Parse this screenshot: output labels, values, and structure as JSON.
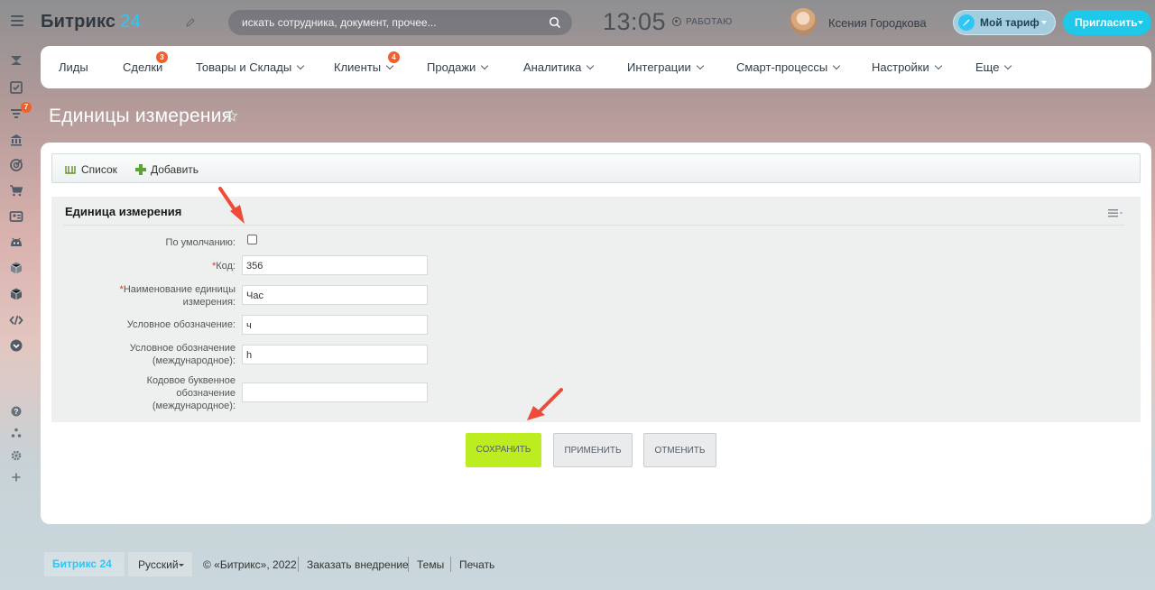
{
  "header": {
    "logo_text": "Битрикс",
    "logo_num": "24",
    "search_placeholder": "искать сотрудника, документ, прочее...",
    "time": "13:05",
    "work_status": "РАБОТАЮ",
    "user_name": "Ксения Городкова",
    "tariff_label": "Мой тариф",
    "invite_label": "Пригласить"
  },
  "left_bar": {
    "badge_count": "7",
    "icons": [
      "feed-icon",
      "tasks-icon",
      "crm-funnel-icon",
      "bank-icon",
      "target-icon",
      "cart-icon",
      "contact-card-icon",
      "robot-icon",
      "box-icon",
      "cube-icon",
      "code-icon",
      "chevron-down-circle-icon",
      "help-icon",
      "structure-icon",
      "settings-icon",
      "plus-icon"
    ]
  },
  "menu": {
    "items": [
      {
        "label": "Лиды",
        "badge": "",
        "has_chevron": false
      },
      {
        "label": "Сделки",
        "badge": "3",
        "has_chevron": false
      },
      {
        "label": "Товары и Склады",
        "badge": "",
        "has_chevron": true
      },
      {
        "label": "Клиенты",
        "badge": "4",
        "has_chevron": true
      },
      {
        "label": "Продажи",
        "badge": "",
        "has_chevron": true
      },
      {
        "label": "Аналитика",
        "badge": "",
        "has_chevron": true
      },
      {
        "label": "Интеграции",
        "badge": "",
        "has_chevron": true
      },
      {
        "label": "Смарт-процессы",
        "badge": "",
        "has_chevron": true
      },
      {
        "label": "Настройки",
        "badge": "",
        "has_chevron": true
      },
      {
        "label": "Еще",
        "badge": "",
        "has_chevron": true
      }
    ]
  },
  "page_title": "Единицы измерения",
  "toolbar": {
    "list_label": "Список",
    "add_label": "Добавить"
  },
  "form": {
    "section_title": "Единица измерения",
    "default_label": "По умолчанию:",
    "default_checked": false,
    "fields": [
      {
        "label": "Код:",
        "required": true,
        "value": "356"
      },
      {
        "label": "Наименование единицы измерения:",
        "required": true,
        "value": "Час"
      },
      {
        "label": "Условное обозначение:",
        "required": false,
        "value": "ч"
      },
      {
        "label": "Условное обозначение (международное):",
        "required": false,
        "value": "h"
      },
      {
        "label": "Кодовое буквенное обозначение (международное):",
        "required": false,
        "value": ""
      }
    ],
    "required_mark": "*"
  },
  "buttons": {
    "save": "Сохранить",
    "apply": "Применить",
    "cancel": "Отменить"
  },
  "footer": {
    "logo": "Битрикс 24",
    "language": "Русский",
    "copyright": "© «Битрикс», 2022",
    "order_link": "Заказать внедрение",
    "themes_link": "Темы",
    "print_link": "Печать"
  },
  "colors": {
    "accent": "#2fc6f6",
    "badge": "#f0602c",
    "save_button": "#bbed21",
    "annotation_arrow": "#f04a38"
  }
}
